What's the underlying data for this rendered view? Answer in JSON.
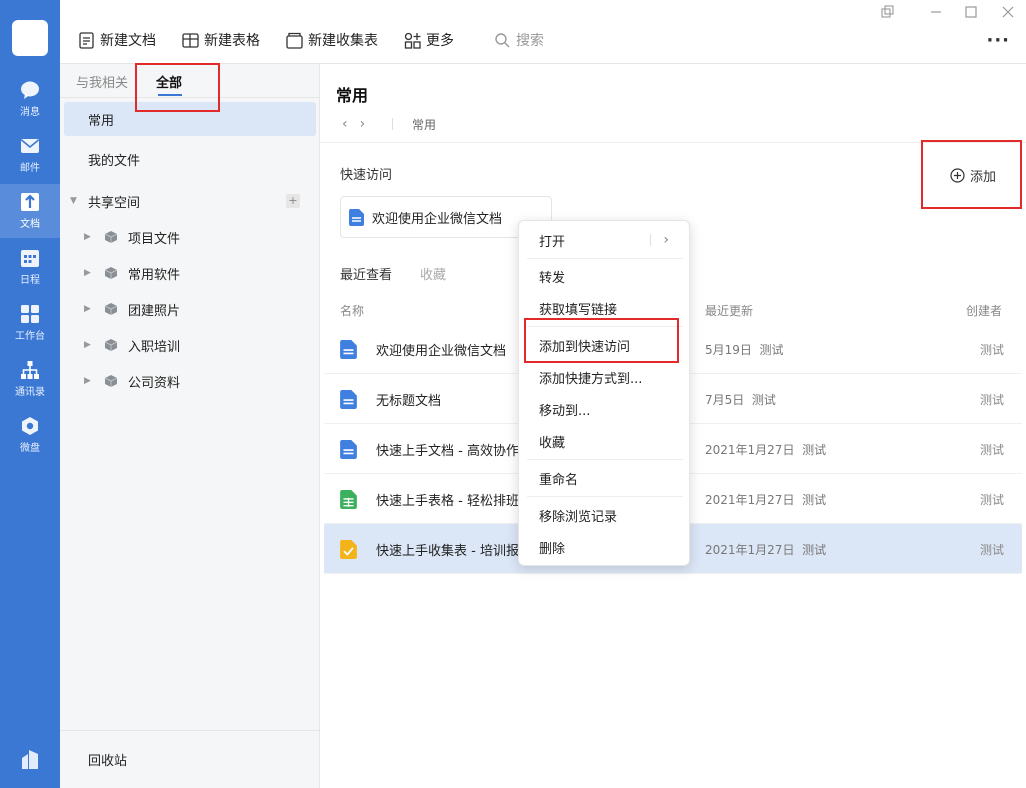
{
  "rail": {
    "items": [
      {
        "label": "消息",
        "icon": "chat-icon"
      },
      {
        "label": "邮件",
        "icon": "mail-icon"
      },
      {
        "label": "文档",
        "icon": "document-icon"
      },
      {
        "label": "日程",
        "icon": "calendar-icon"
      },
      {
        "label": "工作台",
        "icon": "workbench-icon"
      },
      {
        "label": "通讯录",
        "icon": "contacts-icon"
      },
      {
        "label": "微盘",
        "icon": "drive-icon"
      }
    ],
    "active": "文档"
  },
  "toolbar": {
    "new_doc": "新建文档",
    "new_sheet": "新建表格",
    "new_form": "新建收集表",
    "more": "更多",
    "search_placeholder": "搜索",
    "overflow": "···"
  },
  "leftpane": {
    "tabs": [
      "与我相关",
      "全部"
    ],
    "active_tab": "全部",
    "items": [
      "常用",
      "我的文件"
    ],
    "selected_item": "常用",
    "shared_space": "共享空间",
    "shared_add": "+",
    "folders": [
      "项目文件",
      "常用软件",
      "团建照片",
      "入职培训",
      "公司资料"
    ],
    "recycle": "回收站"
  },
  "main": {
    "title": "常用",
    "back": "‹",
    "forward": "›",
    "breadcrumb": "常用",
    "quick_access_label": "快速访问",
    "add_label": "添加",
    "quick_card": "欢迎使用企业微信文档",
    "subtabs": [
      "最近查看",
      "收藏"
    ],
    "columns": {
      "name": "名称",
      "updated": "最近更新",
      "creator": "创建者"
    },
    "rows": [
      {
        "name": "欢迎使用企业微信文档",
        "date": "5月19日",
        "by": "测试",
        "owner": "测试",
        "type": "doc"
      },
      {
        "name": "无标题文档",
        "date": "7月5日",
        "by": "测试",
        "owner": "测试",
        "type": "doc"
      },
      {
        "name": "快速上手文档 - 高效协作",
        "date": "2021年1月27日",
        "by": "测试",
        "owner": "测试",
        "type": "doc"
      },
      {
        "name": "快速上手表格 - 轻松排班",
        "date": "2021年1月27日",
        "by": "测试",
        "owner": "测试",
        "type": "sheet"
      },
      {
        "name": "快速上手收集表 - 培训报名",
        "date": "2021年1月27日",
        "by": "测试",
        "owner": "测试",
        "type": "form"
      }
    ]
  },
  "context_menu": {
    "open": "打开",
    "forward": "转发",
    "get_link": "获取填写链接",
    "add_quick": "添加到快速访问",
    "add_shortcut": "添加快捷方式到...",
    "move_to": "移动到...",
    "favorite": "收藏",
    "rename": "重命名",
    "remove_history": "移除浏览记录",
    "delete": "删除",
    "submenu_chevron": "›"
  },
  "colors": {
    "rail": "#3a78d4",
    "accent": "#3a78d4",
    "selected_bg": "#dbe6f6",
    "annotation_red": "#e32a2a",
    "doc_blue": "#3e7fe0",
    "sheet_green": "#3bb15e",
    "form_yellow": "#f5b31a"
  }
}
